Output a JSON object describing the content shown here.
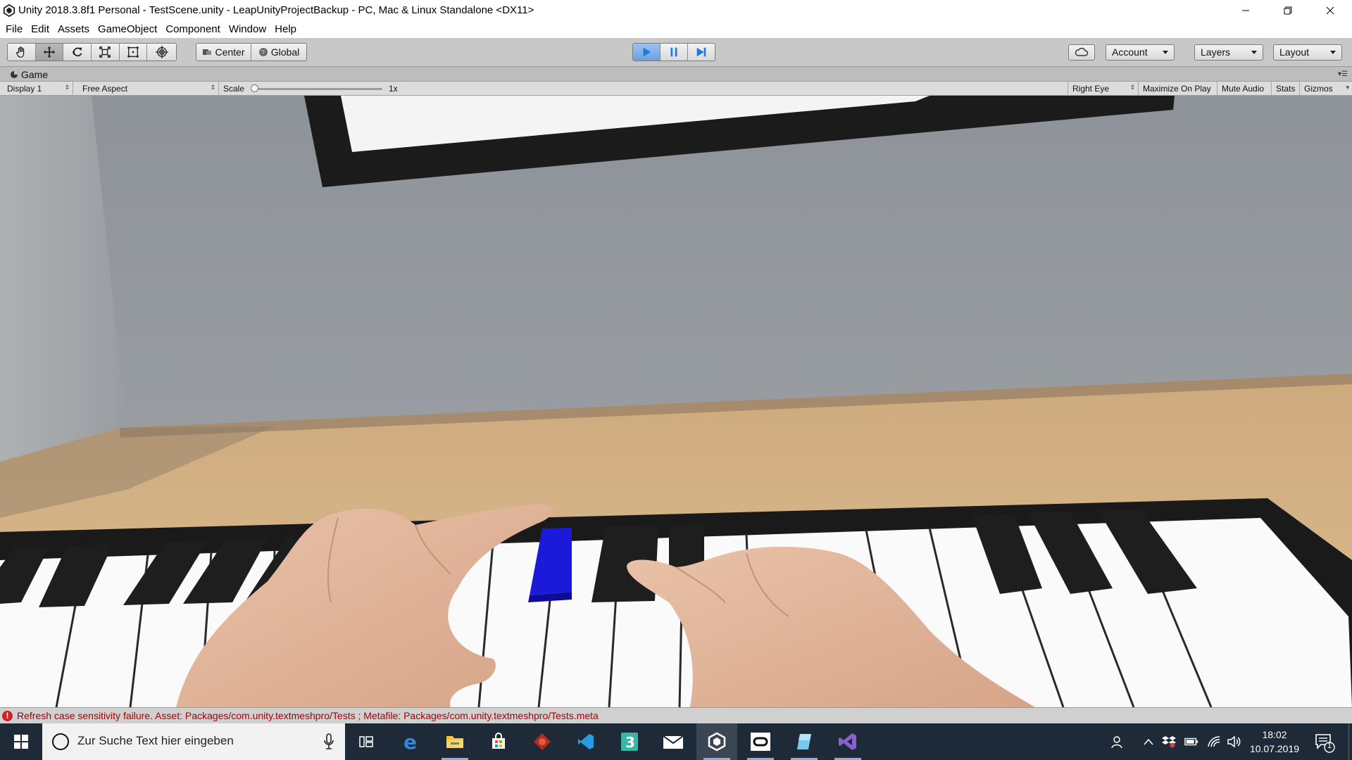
{
  "window": {
    "title": "Unity 2018.3.8f1 Personal - TestScene.unity - LeapUnityProjectBackup - PC, Mac & Linux Standalone <DX11>"
  },
  "menu": [
    "File",
    "Edit",
    "Assets",
    "GameObject",
    "Component",
    "Window",
    "Help"
  ],
  "toolbar": {
    "tools": [
      "hand-icon",
      "move-icon",
      "rotate-icon",
      "scale-icon",
      "rect-tool-icon",
      "transform-icon"
    ],
    "pivot_label": "Center",
    "space_label": "Global",
    "account_label": "Account",
    "layers_label": "Layers",
    "layout_label": "Layout",
    "colors": {
      "play_active": "#1f7ae0",
      "toolbar_bg": "#c8c8c8"
    }
  },
  "game_tab": {
    "label": "Game"
  },
  "game_toolbar": {
    "display": "Display 1",
    "aspect": "Free Aspect",
    "scale_label": "Scale",
    "scale_value": "1x",
    "eye": "Right Eye",
    "maximize": "Maximize On Play",
    "mute": "Mute Audio",
    "stats": "Stats",
    "gizmos": "Gizmos"
  },
  "console": {
    "message": "Refresh case sensitivity failure. Asset: Packages/com.unity.textmeshpro/Tests ; Metafile: Packages/com.unity.textmeshpro/Tests.meta",
    "color": "#d71f1f"
  },
  "taskbar": {
    "search_placeholder": "Zur Suche Text hier eingeben",
    "apps": [
      "task-view-icon",
      "edge-icon",
      "file-explorer-icon",
      "store-icon",
      "app-red-icon",
      "vscode-icon",
      "app-3-icon",
      "mail-icon",
      "unity-icon",
      "oculus-icon",
      "app-blue-icon",
      "visual-studio-icon"
    ],
    "time": "18:02",
    "date": "10.07.2019",
    "notification_count": "1"
  }
}
